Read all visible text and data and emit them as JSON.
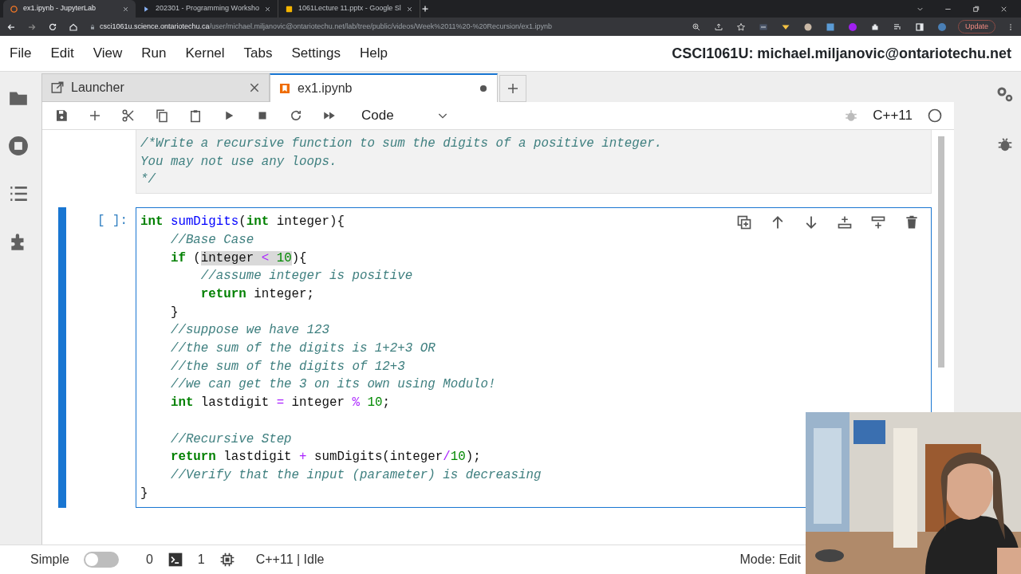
{
  "browser": {
    "tabs": [
      {
        "title": "ex1.ipynb - JupyterLab",
        "selected": true
      },
      {
        "title": "202301 - Programming Worksho",
        "selected": false
      },
      {
        "title": "1061Lecture 11.pptx - Google Sl",
        "selected": false
      }
    ],
    "address": {
      "host": "csci1061u.science.ontariotechu.ca",
      "path": "/user/michael.miljanovic@ontariotechu.net/lab/tree/public/videos/Week%2011%20-%20Recursion/ex1.ipynb"
    },
    "update_button": "Update"
  },
  "menu": [
    "File",
    "Edit",
    "View",
    "Run",
    "Kernel",
    "Tabs",
    "Settings",
    "Help"
  ],
  "user_title": "CSCI1061U: michael.miljanovic@ontariotechu.net",
  "doc_tabs": [
    {
      "label": "Launcher",
      "kind": "launcher",
      "selected": false,
      "dirty": false
    },
    {
      "label": "ex1.ipynb",
      "kind": "notebook",
      "selected": true,
      "dirty": true
    }
  ],
  "toolbar": {
    "cell_type": "Code",
    "kernel": "C++11",
    "kernel_busy": false
  },
  "cells": [
    {
      "kind": "raw",
      "lines": [
        "/*Write a recursive function to sum the digits of a positive integer.",
        "You may not use any loops.",
        "*/"
      ]
    },
    {
      "kind": "code",
      "active": true,
      "prompt": "[ ]:",
      "lines": [
        {
          "tokens": [
            {
              "kind": "kw",
              "text": "int"
            },
            {
              "kind": "fn",
              "text": " sumDigits"
            },
            {
              "kind": "txt",
              "text": "("
            },
            {
              "kind": "kw",
              "text": "int"
            },
            {
              "kind": "txt",
              "text": " integer){"
            }
          ]
        },
        {
          "tokens": [
            {
              "kind": "cm",
              "text": "    //Base Case"
            }
          ]
        },
        {
          "tokens": [
            {
              "kind": "kw",
              "text": "    if",
              "highlighted": false
            },
            {
              "kind": "txt",
              "text": " (",
              "highlighted": false
            },
            {
              "kind": "txt",
              "text": "integer ",
              "highlighted": true
            },
            {
              "kind": "op",
              "text": "<",
              "highlighted": true
            },
            {
              "kind": "num",
              "text": " 10",
              "highlighted": true
            },
            {
              "kind": "txt",
              "text": "){",
              "highlighted": false
            }
          ]
        },
        {
          "tokens": [
            {
              "kind": "cm",
              "text": "        //assume integer is positive"
            }
          ]
        },
        {
          "tokens": [
            {
              "kind": "kw",
              "text": "        return"
            },
            {
              "kind": "txt",
              "text": " integer;"
            }
          ]
        },
        {
          "tokens": [
            {
              "kind": "txt",
              "text": "    }"
            }
          ]
        },
        {
          "tokens": [
            {
              "kind": "cm",
              "text": "    //suppose we have 123"
            }
          ]
        },
        {
          "tokens": [
            {
              "kind": "cm",
              "text": "    //the sum of the digits is 1+2+3 OR"
            }
          ]
        },
        {
          "tokens": [
            {
              "kind": "cm",
              "text": "    //the sum of the digits of 12+3"
            }
          ]
        },
        {
          "tokens": [
            {
              "kind": "cm",
              "text": "    //we can get the 3 on its own using Modulo!"
            }
          ]
        },
        {
          "tokens": [
            {
              "kind": "kw",
              "text": "    int"
            },
            {
              "kind": "txt",
              "text": " lastdigit "
            },
            {
              "kind": "op",
              "text": "="
            },
            {
              "kind": "txt",
              "text": " integer "
            },
            {
              "kind": "op",
              "text": "%"
            },
            {
              "kind": "num",
              "text": " 10"
            },
            {
              "kind": "txt",
              "text": ";"
            }
          ]
        },
        {
          "kind": "blank"
        },
        {
          "tokens": [
            {
              "kind": "cm",
              "text": "    //Recursive Step"
            }
          ]
        },
        {
          "tokens": [
            {
              "kind": "kw",
              "text": "    return"
            },
            {
              "kind": "txt",
              "text": " lastdigit "
            },
            {
              "kind": "op",
              "text": "+"
            },
            {
              "kind": "txt",
              "text": " sumDigits(integer"
            },
            {
              "kind": "op",
              "text": "/"
            },
            {
              "kind": "num",
              "text": "10"
            },
            {
              "kind": "txt",
              "text": ");"
            }
          ]
        },
        {
          "tokens": [
            {
              "kind": "cm",
              "text": "    //Verify that the input (parameter) is decreasing"
            }
          ]
        },
        {
          "tokens": [
            {
              "kind": "txt",
              "text": "}"
            }
          ]
        }
      ]
    }
  ],
  "status_bar": {
    "mode_label": "Simple",
    "simple_mode": false,
    "terminals": "0",
    "kernels": "1",
    "kernel_status": "C++11 | Idle",
    "mode": "Mode: Edit"
  }
}
